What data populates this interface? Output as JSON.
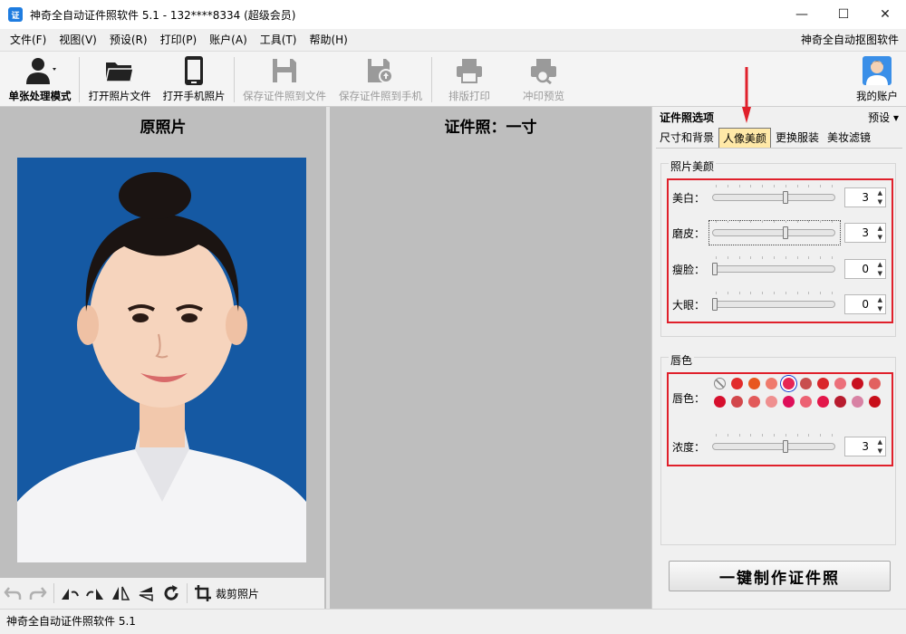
{
  "window": {
    "app_icon_text": "证",
    "title": "神奇全自动证件照软件 5.1 - 132****8334 (超级会员)",
    "minimize_glyph": "—",
    "maximize_glyph": "☐",
    "close_glyph": "✕"
  },
  "menu": {
    "items": [
      "文件(F)",
      "视图(V)",
      "预设(R)",
      "打印(P)",
      "账户(A)",
      "工具(T)",
      "帮助(H)"
    ],
    "right_link": "神奇全自动抠图软件"
  },
  "toolbar": {
    "single_mode": "单张处理模式",
    "open_file": "打开照片文件",
    "open_phone": "打开手机照片",
    "save_file": "保存证件照到文件",
    "save_phone": "保存证件照到手机",
    "layout_print": "排版打印",
    "print_preview": "冲印预览",
    "my_account": "我的账户"
  },
  "left": {
    "title": "原照片",
    "crop_label": "裁剪照片"
  },
  "middle": {
    "title": "证件照：一寸"
  },
  "right": {
    "options_title": "证件照选项",
    "preset_label": "预设 ▾",
    "tabs": [
      "尺寸和背景",
      "人像美颜",
      "更换服装",
      "美妆滤镜"
    ],
    "active_tab": 1,
    "beauty_group_title": "照片美颜",
    "sliders": [
      {
        "label": "美白：",
        "value": "3",
        "level": 0.6
      },
      {
        "label": "磨皮：",
        "value": "3",
        "level": 0.6
      },
      {
        "label": "瘦脸：",
        "value": "0",
        "level": 0
      },
      {
        "label": "大眼：",
        "value": "0",
        "level": 0
      }
    ],
    "lip_group_title": "唇色",
    "lip_label": "唇色：",
    "lip_colors_row1": [
      "none",
      "#e22b2b",
      "#e8571f",
      "#ef7a6c",
      "#e62553",
      "#c84f4f",
      "#d9262b",
      "#ec6f7a",
      "#c80f1f",
      "#e2615f"
    ],
    "lip_colors_row2": [
      "#d60f2d",
      "#d2474b",
      "#e25a5a",
      "#ef8f8f",
      "#de0f5a",
      "#ec6273",
      "#e3174a",
      "#b81c2f",
      "#d882a4",
      "#c80f1a"
    ],
    "lip_selected": 4,
    "density_label": "浓度：",
    "density_value": "3",
    "density_level": 0.6,
    "make_button": "一键制作证件照"
  },
  "status": {
    "text": "神奇全自动证件照软件 5.1"
  },
  "colors": {
    "highlight_red": "#e0202b",
    "active_tab": "#ffe9a8",
    "photo_background": "#1559a3"
  }
}
